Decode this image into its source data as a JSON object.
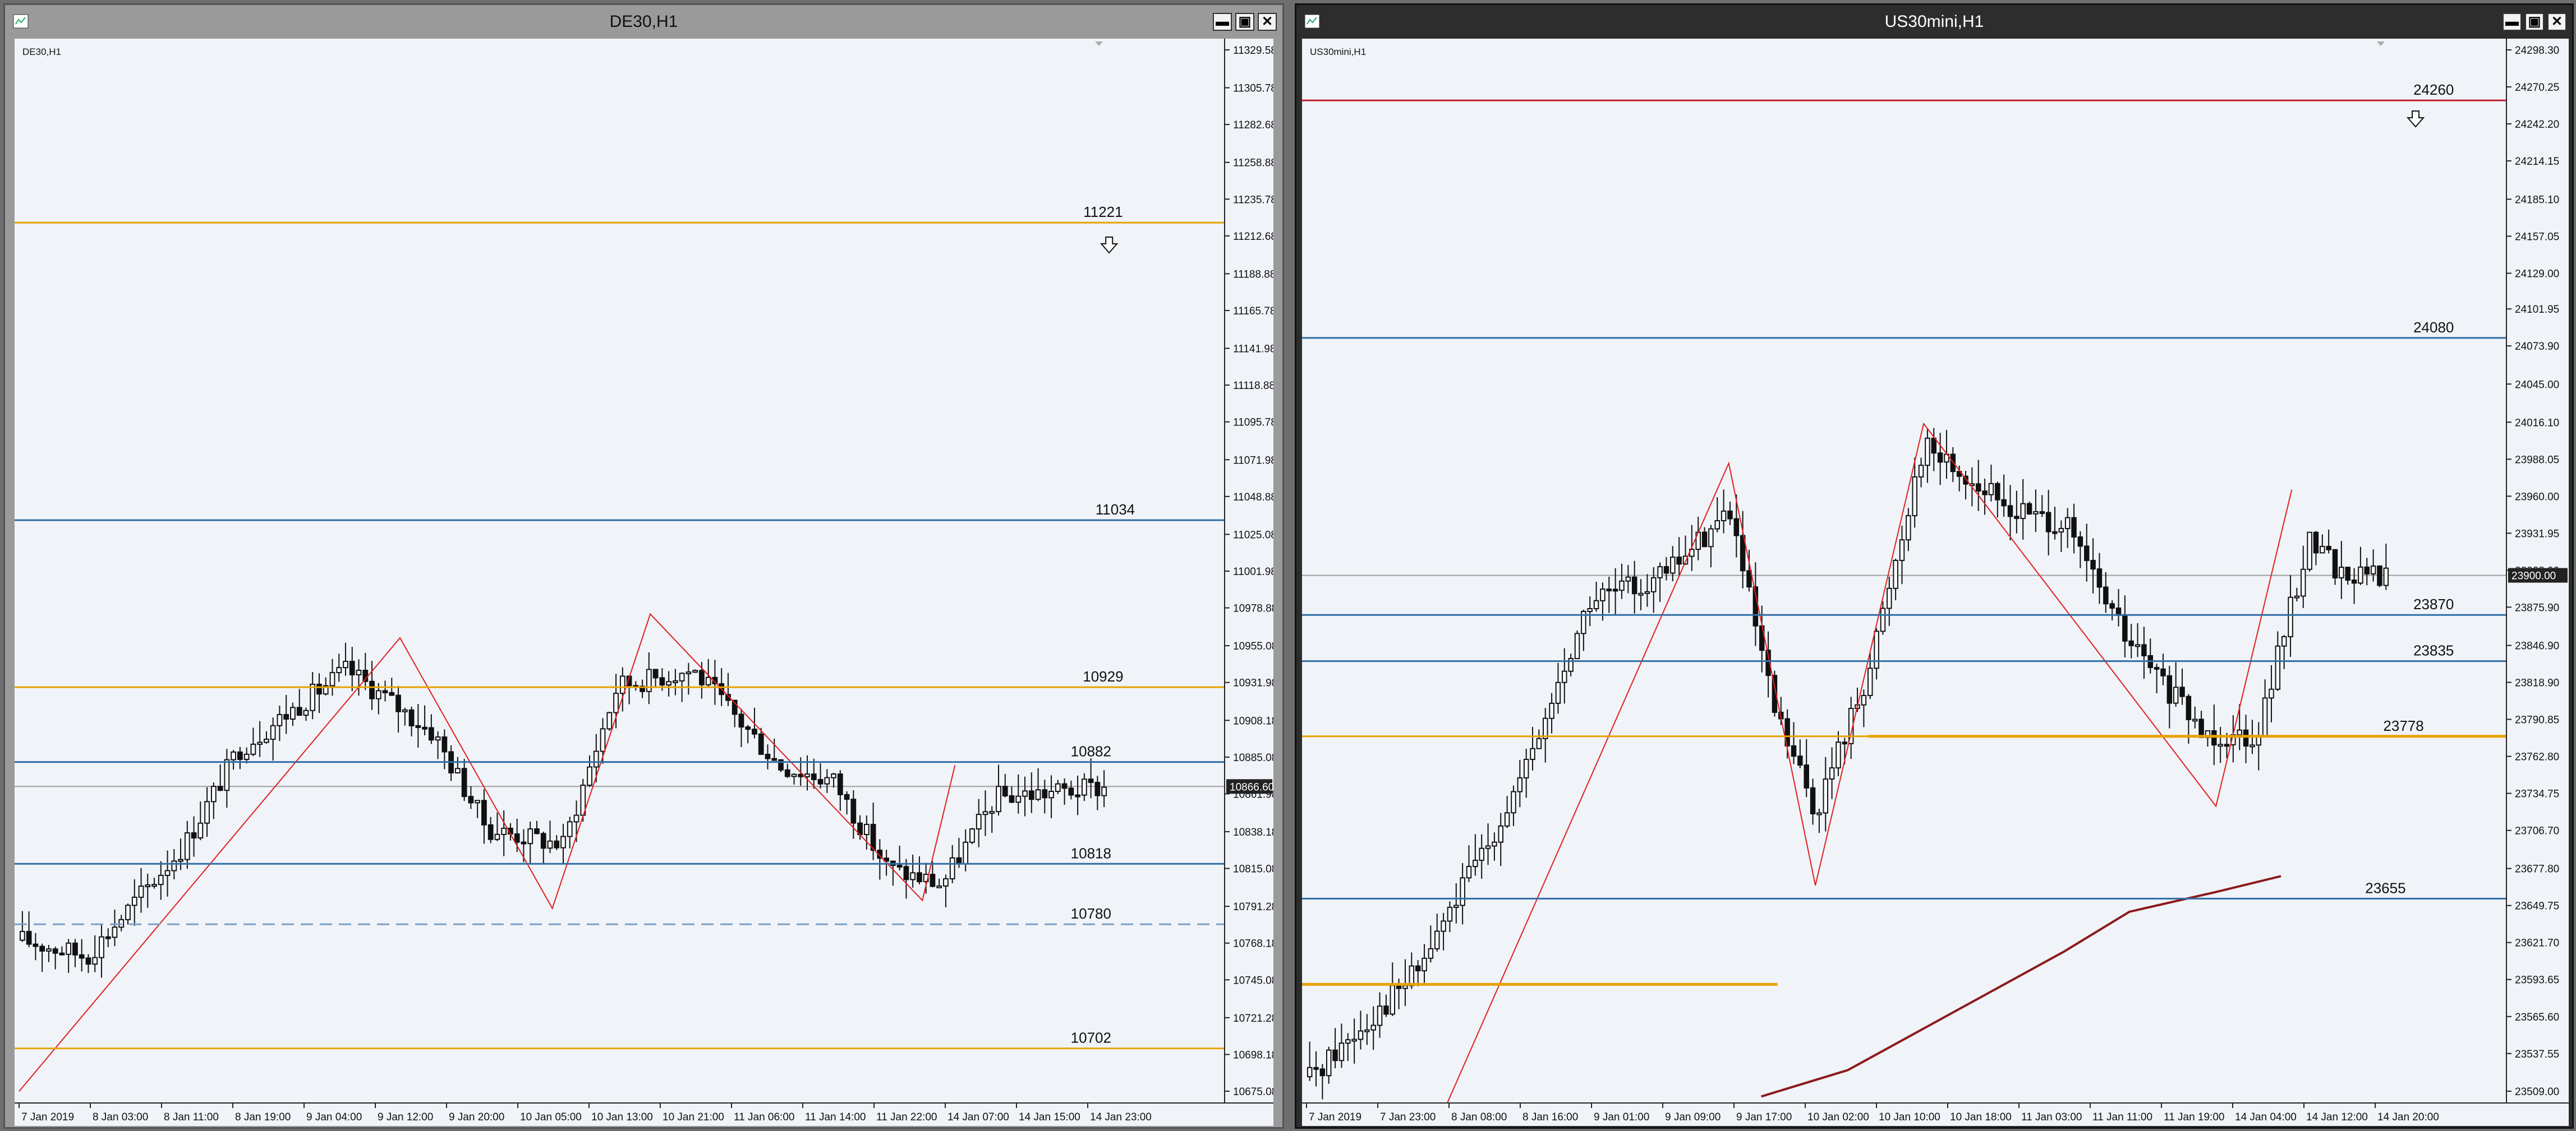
{
  "left": {
    "title": "DE30,H1",
    "symbol": "DE30,H1",
    "prices": [
      "11329.58",
      "11305.78",
      "11282.68",
      "11258.88",
      "11235.78",
      "11212.68",
      "11188.88",
      "11165.78",
      "11141.98",
      "11118.88",
      "11095.78",
      "11071.98",
      "11048.88",
      "11025.08",
      "11001.98",
      "10978.88",
      "10955.08",
      "10931.98",
      "10908.18",
      "10885.08",
      "10861.98",
      "10838.18",
      "10815.08",
      "10791.28",
      "10768.18",
      "10745.08",
      "10721.28",
      "10698.18",
      "10675.08"
    ],
    "current_price": "10866.60",
    "levels": [
      {
        "value": "11221",
        "color": "#e8a200",
        "price": 11221
      },
      {
        "value": "11034",
        "color": "#2f6ea6",
        "price": 11034
      },
      {
        "value": "10929",
        "color": "#e8a200",
        "price": 10929
      },
      {
        "value": "10882",
        "color": "#2f6ea6",
        "price": 10882
      },
      {
        "value": "10818",
        "color": "#2f6ea6",
        "price": 10818
      },
      {
        "value": "10780",
        "color": "#7aa0c8",
        "price": 10780,
        "dashed": true
      },
      {
        "value": "10702",
        "color": "#e8a200",
        "price": 10702
      }
    ],
    "times": [
      "7 Jan 2019",
      "8 Jan 03:00",
      "8 Jan 11:00",
      "8 Jan 19:00",
      "9 Jan 04:00",
      "9 Jan 12:00",
      "9 Jan 20:00",
      "10 Jan 05:00",
      "10 Jan 13:00",
      "10 Jan 21:00",
      "11 Jan 06:00",
      "11 Jan 14:00",
      "11 Jan 22:00",
      "14 Jan 07:00",
      "14 Jan 15:00",
      "14 Jan 23:00"
    ],
    "buttons": {
      "minimize": "▬",
      "maximize": "▣",
      "close": "✕"
    },
    "arrow_icon": "down-arrow-icon"
  },
  "right": {
    "title": "US30mini,H1",
    "symbol": "US30mini,H1",
    "prices": [
      "24298.30",
      "24270.25",
      "24242.20",
      "24214.15",
      "24185.10",
      "24157.05",
      "24129.00",
      "24101.95",
      "24073.90",
      "24045.00",
      "24016.10",
      "23988.05",
      "23960.00",
      "23931.95",
      "23903.90",
      "23875.90",
      "23846.90",
      "23818.90",
      "23790.85",
      "23762.80",
      "23734.75",
      "23706.70",
      "23677.80",
      "23649.75",
      "23621.70",
      "23593.65",
      "23565.60",
      "23537.55",
      "23509.00"
    ],
    "current_price": "23900.00",
    "levels": [
      {
        "value": "24260",
        "color": "#c0202a",
        "price": 24260
      },
      {
        "value": "24080",
        "color": "#2f6ea6",
        "price": 24080
      },
      {
        "value": "23870",
        "color": "#2f6ea6",
        "price": 23870
      },
      {
        "value": "23835",
        "color": "#2f6ea6",
        "price": 23835
      },
      {
        "value": "23778",
        "color": "#e8a200",
        "price": 23778
      },
      {
        "value": "23655",
        "color": "#2f6ea6",
        "price": 23655
      }
    ],
    "times": [
      "7 Jan 2019",
      "7 Jan 23:00",
      "8 Jan 08:00",
      "8 Jan 16:00",
      "9 Jan 01:00",
      "9 Jan 09:00",
      "9 Jan 17:00",
      "10 Jan 02:00",
      "10 Jan 10:00",
      "10 Jan 18:00",
      "11 Jan 03:00",
      "11 Jan 11:00",
      "11 Jan 19:00",
      "14 Jan 04:00",
      "14 Jan 12:00",
      "14 Jan 20:00"
    ],
    "buttons": {
      "minimize": "▬",
      "maximize": "▣",
      "close": "✕"
    },
    "arrow_icon": "down-arrow-icon"
  }
}
